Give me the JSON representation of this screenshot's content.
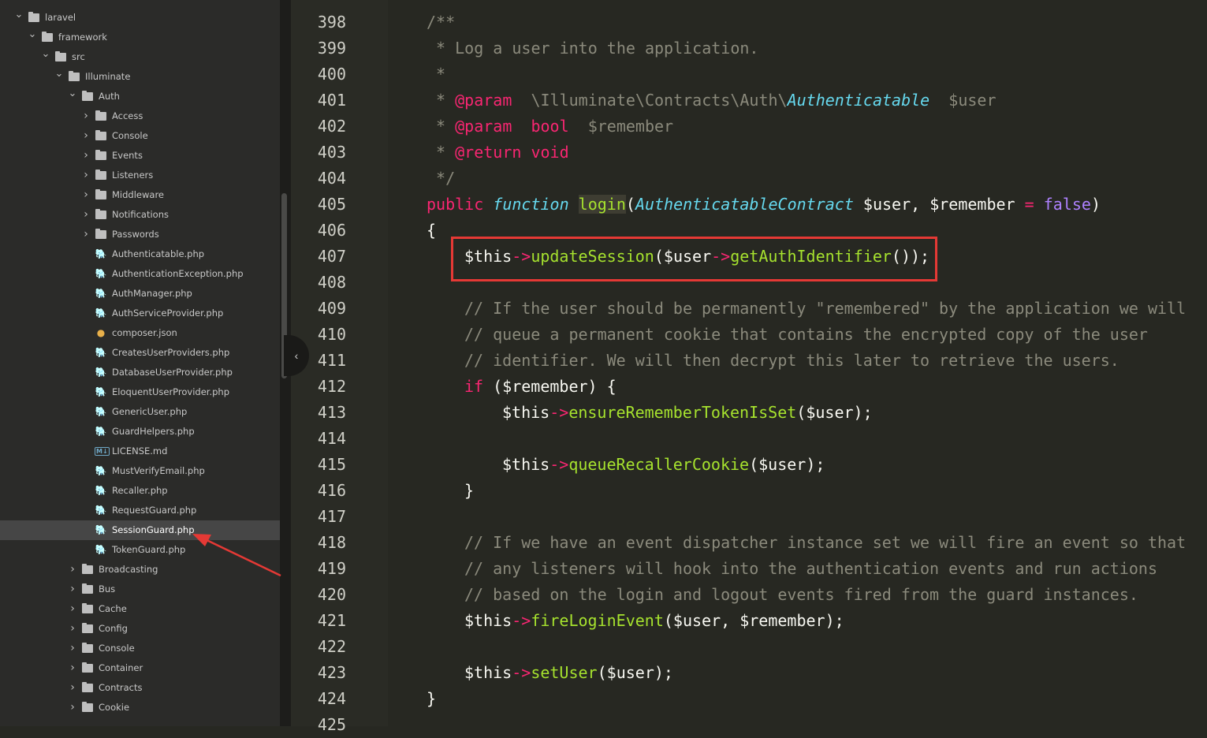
{
  "file_tree": [
    {
      "label": "laravel",
      "type": "folder",
      "indent": 1,
      "expanded": true
    },
    {
      "label": "framework",
      "type": "folder",
      "indent": 2,
      "expanded": true
    },
    {
      "label": "src",
      "type": "folder",
      "indent": 3,
      "expanded": true
    },
    {
      "label": "Illuminate",
      "type": "folder",
      "indent": 4,
      "expanded": true
    },
    {
      "label": "Auth",
      "type": "folder",
      "indent": 5,
      "expanded": true
    },
    {
      "label": "Access",
      "type": "folder",
      "indent": 6,
      "expanded": false
    },
    {
      "label": "Console",
      "type": "folder",
      "indent": 6,
      "expanded": false
    },
    {
      "label": "Events",
      "type": "folder",
      "indent": 6,
      "expanded": false
    },
    {
      "label": "Listeners",
      "type": "folder",
      "indent": 6,
      "expanded": false
    },
    {
      "label": "Middleware",
      "type": "folder",
      "indent": 6,
      "expanded": false
    },
    {
      "label": "Notifications",
      "type": "folder",
      "indent": 6,
      "expanded": false
    },
    {
      "label": "Passwords",
      "type": "folder",
      "indent": 6,
      "expanded": false
    },
    {
      "label": "Authenticatable.php",
      "type": "php",
      "indent": 6
    },
    {
      "label": "AuthenticationException.php",
      "type": "php",
      "indent": 6
    },
    {
      "label": "AuthManager.php",
      "type": "php",
      "indent": 6
    },
    {
      "label": "AuthServiceProvider.php",
      "type": "php",
      "indent": 6
    },
    {
      "label": "composer.json",
      "type": "json",
      "indent": 6
    },
    {
      "label": "CreatesUserProviders.php",
      "type": "php",
      "indent": 6
    },
    {
      "label": "DatabaseUserProvider.php",
      "type": "php",
      "indent": 6
    },
    {
      "label": "EloquentUserProvider.php",
      "type": "php",
      "indent": 6
    },
    {
      "label": "GenericUser.php",
      "type": "php",
      "indent": 6
    },
    {
      "label": "GuardHelpers.php",
      "type": "php",
      "indent": 6
    },
    {
      "label": "LICENSE.md",
      "type": "md",
      "indent": 6
    },
    {
      "label": "MustVerifyEmail.php",
      "type": "php",
      "indent": 6
    },
    {
      "label": "Recaller.php",
      "type": "php",
      "indent": 6
    },
    {
      "label": "RequestGuard.php",
      "type": "php",
      "indent": 6
    },
    {
      "label": "SessionGuard.php",
      "type": "php",
      "indent": 6,
      "selected": true
    },
    {
      "label": "TokenGuard.php",
      "type": "php",
      "indent": 6
    },
    {
      "label": "Broadcasting",
      "type": "folder",
      "indent": 5,
      "expanded": false
    },
    {
      "label": "Bus",
      "type": "folder",
      "indent": 5,
      "expanded": false
    },
    {
      "label": "Cache",
      "type": "folder",
      "indent": 5,
      "expanded": false
    },
    {
      "label": "Config",
      "type": "folder",
      "indent": 5,
      "expanded": false
    },
    {
      "label": "Console",
      "type": "folder",
      "indent": 5,
      "expanded": false
    },
    {
      "label": "Container",
      "type": "folder",
      "indent": 5,
      "expanded": false
    },
    {
      "label": "Contracts",
      "type": "folder",
      "indent": 5,
      "expanded": false
    },
    {
      "label": "Cookie",
      "type": "folder",
      "indent": 5,
      "expanded": false
    }
  ],
  "code_lines": [
    {
      "num": "398",
      "indent": 0,
      "tokens": [
        [
          "cm",
          "/**"
        ]
      ]
    },
    {
      "num": "399",
      "indent": 0,
      "tokens": [
        [
          "cm",
          " * Log a user into the application."
        ]
      ]
    },
    {
      "num": "400",
      "indent": 0,
      "tokens": [
        [
          "cm",
          " *"
        ]
      ]
    },
    {
      "num": "401",
      "indent": 0,
      "tokens": [
        [
          "cm",
          " * "
        ],
        [
          "tag",
          "@param"
        ],
        [
          "cm",
          "  \\Illuminate\\Contracts\\Auth\\"
        ],
        [
          "cls",
          "Authenticatable"
        ],
        [
          "cm",
          "  $user"
        ]
      ]
    },
    {
      "num": "402",
      "indent": 0,
      "tokens": [
        [
          "cm",
          " * "
        ],
        [
          "tag",
          "@param"
        ],
        [
          "cm",
          "  "
        ],
        [
          "tag",
          "bool"
        ],
        [
          "cm",
          "  $remember"
        ]
      ]
    },
    {
      "num": "403",
      "indent": 0,
      "tokens": [
        [
          "cm",
          " * "
        ],
        [
          "tag",
          "@return"
        ],
        [
          "cm",
          " "
        ],
        [
          "tag",
          "void"
        ]
      ]
    },
    {
      "num": "404",
      "indent": 0,
      "tokens": [
        [
          "cm",
          " */"
        ]
      ]
    },
    {
      "num": "405",
      "indent": 0,
      "tokens": [
        [
          "kw",
          "public"
        ],
        [
          "var",
          " "
        ],
        [
          "cls",
          "function"
        ],
        [
          "var",
          " "
        ],
        [
          "fndef",
          "login"
        ],
        [
          "var",
          "("
        ],
        [
          "cls",
          "AuthenticatableContract"
        ],
        [
          "var",
          " $user, $remember "
        ],
        [
          "kw",
          "="
        ],
        [
          "var",
          " "
        ],
        [
          "bool",
          "false"
        ],
        [
          "var",
          ")"
        ]
      ]
    },
    {
      "num": "406",
      "indent": 0,
      "tokens": [
        [
          "var",
          "{"
        ]
      ]
    },
    {
      "num": "407",
      "indent": 1,
      "tokens": [
        [
          "var",
          "$this"
        ],
        [
          "kw",
          "->"
        ],
        [
          "fn",
          "updateSession"
        ],
        [
          "var",
          "($user"
        ],
        [
          "kw",
          "->"
        ],
        [
          "fn",
          "getAuthIdentifier"
        ],
        [
          "var",
          "());"
        ]
      ]
    },
    {
      "num": "408",
      "indent": 0,
      "tokens": []
    },
    {
      "num": "409",
      "indent": 1,
      "tokens": [
        [
          "cm",
          "// If the user should be permanently \"remembered\" by the application we will"
        ]
      ]
    },
    {
      "num": "410",
      "indent": 1,
      "tokens": [
        [
          "cm",
          "// queue a permanent cookie that contains the encrypted copy of the user"
        ]
      ]
    },
    {
      "num": "411",
      "indent": 1,
      "tokens": [
        [
          "cm",
          "// identifier. We will then decrypt this later to retrieve the users."
        ]
      ]
    },
    {
      "num": "412",
      "indent": 1,
      "tokens": [
        [
          "kw",
          "if"
        ],
        [
          "var",
          " ($remember) {"
        ]
      ]
    },
    {
      "num": "413",
      "indent": 2,
      "tokens": [
        [
          "var",
          "$this"
        ],
        [
          "kw",
          "->"
        ],
        [
          "fn",
          "ensureRememberTokenIsSet"
        ],
        [
          "var",
          "($user);"
        ]
      ]
    },
    {
      "num": "414",
      "indent": 0,
      "tokens": []
    },
    {
      "num": "415",
      "indent": 2,
      "tokens": [
        [
          "var",
          "$this"
        ],
        [
          "kw",
          "->"
        ],
        [
          "fn",
          "queueRecallerCookie"
        ],
        [
          "var",
          "($user);"
        ]
      ]
    },
    {
      "num": "416",
      "indent": 1,
      "tokens": [
        [
          "var",
          "}"
        ]
      ]
    },
    {
      "num": "417",
      "indent": 0,
      "tokens": []
    },
    {
      "num": "418",
      "indent": 1,
      "tokens": [
        [
          "cm",
          "// If we have an event dispatcher instance set we will fire an event so that"
        ]
      ]
    },
    {
      "num": "419",
      "indent": 1,
      "tokens": [
        [
          "cm",
          "// any listeners will hook into the authentication events and run actions"
        ]
      ]
    },
    {
      "num": "420",
      "indent": 1,
      "tokens": [
        [
          "cm",
          "// based on the login and logout events fired from the guard instances."
        ]
      ]
    },
    {
      "num": "421",
      "indent": 1,
      "tokens": [
        [
          "var",
          "$this"
        ],
        [
          "kw",
          "->"
        ],
        [
          "fn",
          "fireLoginEvent"
        ],
        [
          "var",
          "($user, $remember);"
        ]
      ]
    },
    {
      "num": "422",
      "indent": 0,
      "tokens": []
    },
    {
      "num": "423",
      "indent": 1,
      "tokens": [
        [
          "var",
          "$this"
        ],
        [
          "kw",
          "->"
        ],
        [
          "fn",
          "setUser"
        ],
        [
          "var",
          "($user);"
        ]
      ]
    },
    {
      "num": "424",
      "indent": 0,
      "tokens": [
        [
          "var",
          "}"
        ]
      ]
    },
    {
      "num": "425",
      "indent": 0,
      "tokens": []
    }
  ],
  "colors": {
    "highlight_box": "#e53935",
    "arrow": "#e53935",
    "editor_bg": "#272822",
    "sidebar_bg": "#2b2b29"
  },
  "collapse_button": {
    "icon": "chevron-left-icon",
    "glyph": "‹"
  }
}
